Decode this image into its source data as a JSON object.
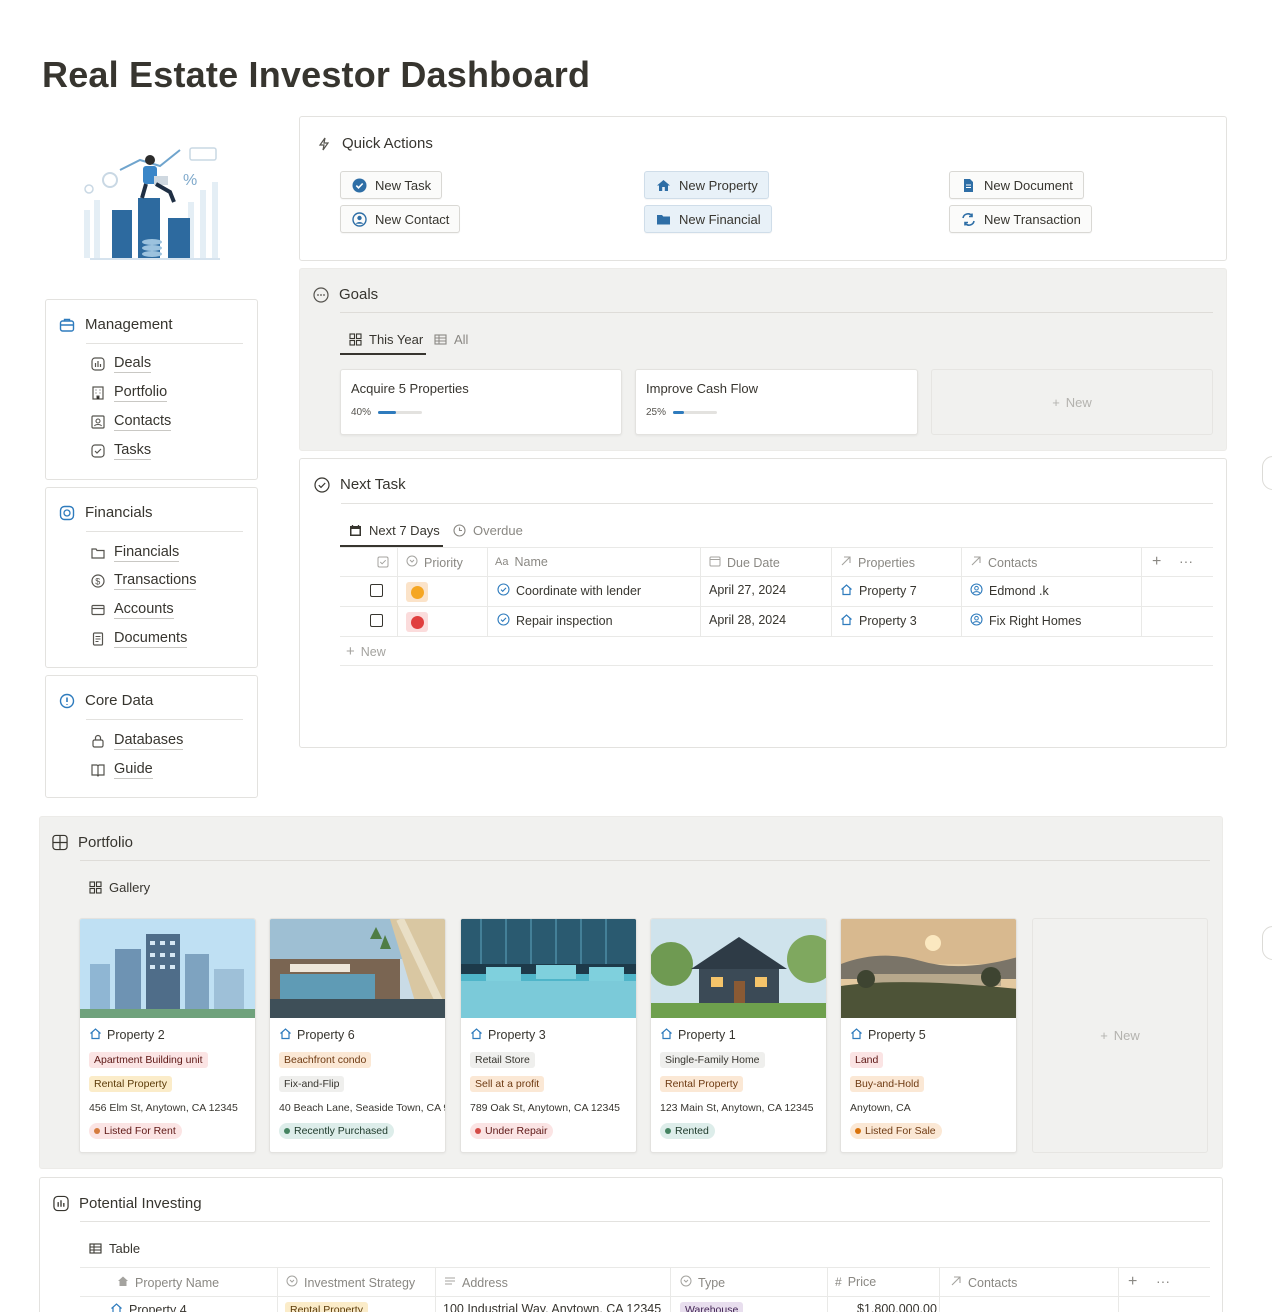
{
  "page_title": "Real Estate Investor Dashboard",
  "sidebar": {
    "management": {
      "title": "Management",
      "items": [
        "Deals",
        "Portfolio",
        "Contacts",
        "Tasks"
      ]
    },
    "financials": {
      "title": "Financials",
      "items": [
        "Financials",
        "Transactions",
        "Accounts",
        "Documents"
      ]
    },
    "core": {
      "title": "Core Data",
      "items": [
        "Databases",
        "Guide"
      ]
    }
  },
  "quick_actions": {
    "title": "Quick Actions",
    "buttons": [
      "New Task",
      "New Contact",
      "New Property",
      "New Financial",
      "New Document",
      "New Transaction"
    ]
  },
  "goals": {
    "title": "Goals",
    "tabs": [
      "This Year",
      "All"
    ],
    "items": [
      {
        "name": "Acquire 5 Properties",
        "percent_label": "40%",
        "progress": 0.4
      },
      {
        "name": "Improve Cash Flow",
        "percent_label": "25%",
        "progress": 0.25
      }
    ],
    "new_label": "New"
  },
  "next_task": {
    "title": "Next Task",
    "tabs": [
      "Next 7 Days",
      "Overdue"
    ],
    "columns": [
      "Priority",
      "Name",
      "Due Date",
      "Properties",
      "Contacts"
    ],
    "rows": [
      {
        "priority_color": "#f5a623",
        "name": "Coordinate with lender",
        "due": "April 27, 2024",
        "property": "Property 7",
        "contact": "Edmond .k"
      },
      {
        "priority_color": "#e03e3e",
        "name": "Repair inspection",
        "due": "April 28, 2024",
        "property": "Property 3",
        "contact": "Fix Right Homes"
      }
    ],
    "new_label": "New"
  },
  "portfolio": {
    "title": "Portfolio",
    "view": "Gallery",
    "new_label": "New",
    "cards": [
      {
        "name": "Property 2",
        "type": "Apartment Building unit",
        "strategy": "Rental Property",
        "address": "456 Elm St, Anytown, CA 12345",
        "status": "Listed For Rent"
      },
      {
        "name": "Property 6",
        "type": "Beachfront condo",
        "strategy": "Fix-and-Flip",
        "address": "40 Beach Lane, Seaside Town, CA 9",
        "status": "Recently Purchased"
      },
      {
        "name": "Property 3",
        "type": "Retail Store",
        "strategy": "Sell at a profit",
        "address": "789 Oak St, Anytown, CA 12345",
        "status": "Under Repair"
      },
      {
        "name": "Property 1",
        "type": "Single-Family Home",
        "strategy": "Rental Property",
        "address": "123 Main St, Anytown, CA 12345",
        "status": "Rented"
      },
      {
        "name": "Property 5",
        "type": "Land",
        "strategy": "Buy-and-Hold",
        "address": "Anytown, CA",
        "status": "Listed For Sale"
      }
    ]
  },
  "potential_investing": {
    "title": "Potential Investing",
    "view": "Table",
    "columns": [
      "Property Name",
      "Investment Strategy",
      "Address",
      "Type",
      "Price",
      "Contacts"
    ],
    "rows": [
      {
        "name": "Property 4",
        "strategy": "Rental Property",
        "address": "100 Industrial Way, Anytown, CA 12345",
        "type": "Warehouse",
        "price": "$1,800,000.00"
      }
    ]
  }
}
